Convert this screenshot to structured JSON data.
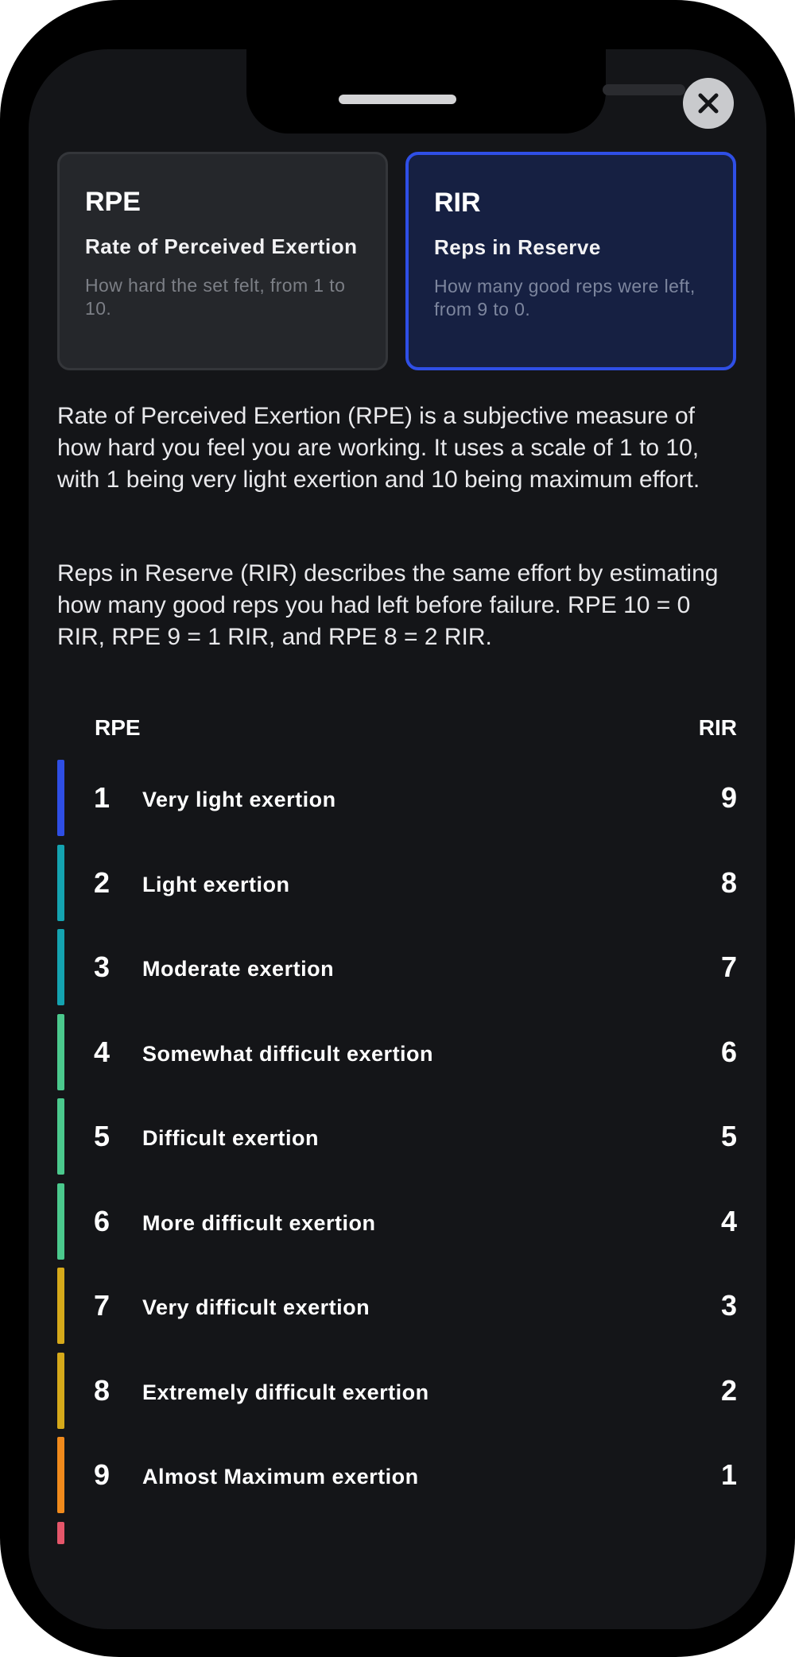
{
  "modal": {
    "close_icon": "close-icon",
    "close_button_color": "#c9cacd"
  },
  "cards": [
    {
      "abbr": "RPE",
      "title": "Rate of Perceived Exertion",
      "description": "How hard the set felt, from 1 to 10.",
      "selected": false
    },
    {
      "abbr": "RIR",
      "title": "Reps in Reserve",
      "description": "How many good reps were left, from 9 to 0.",
      "selected": true,
      "accent": "#2f4fe6"
    }
  ],
  "body": {
    "paragraph_1": "Rate of Perceived Exertion (RPE) is a subjective measure of how hard you feel you are working. It uses a scale of 1 to 10, with 1 being very light exertion and 10 being maximum effort.",
    "paragraph_2": "Reps in Reserve (RIR) describes the same effort by estimating how many good reps you had left before failure. RPE 10 = 0 RIR, RPE 9 = 1 RIR, and RPE 8 = 2 RIR."
  },
  "table": {
    "header_rpe": "RPE",
    "header_rir": "RIR",
    "rows": [
      {
        "rpe": "1",
        "label": "Very light exertion",
        "rir": "9",
        "color": "#2e4ee4"
      },
      {
        "rpe": "2",
        "label": "Light exertion",
        "rir": "8",
        "color": "#14a3b0"
      },
      {
        "rpe": "3",
        "label": "Moderate exertion",
        "rir": "7",
        "color": "#14a3b0"
      },
      {
        "rpe": "4",
        "label": "Somewhat difficult exertion",
        "rir": "6",
        "color": "#4bc98d"
      },
      {
        "rpe": "5",
        "label": "Difficult exertion",
        "rir": "5",
        "color": "#4bc98d"
      },
      {
        "rpe": "6",
        "label": "More difficult exertion",
        "rir": "4",
        "color": "#4bc98d"
      },
      {
        "rpe": "7",
        "label": "Very difficult exertion",
        "rir": "3",
        "color": "#d6a91a"
      },
      {
        "rpe": "8",
        "label": "Extremely difficult exertion",
        "rir": "2",
        "color": "#d6a91a"
      },
      {
        "rpe": "9",
        "label": "Almost Maximum exertion",
        "rir": "1",
        "color": "#f08a1c"
      }
    ],
    "partial_row_color": "#e5566a"
  }
}
